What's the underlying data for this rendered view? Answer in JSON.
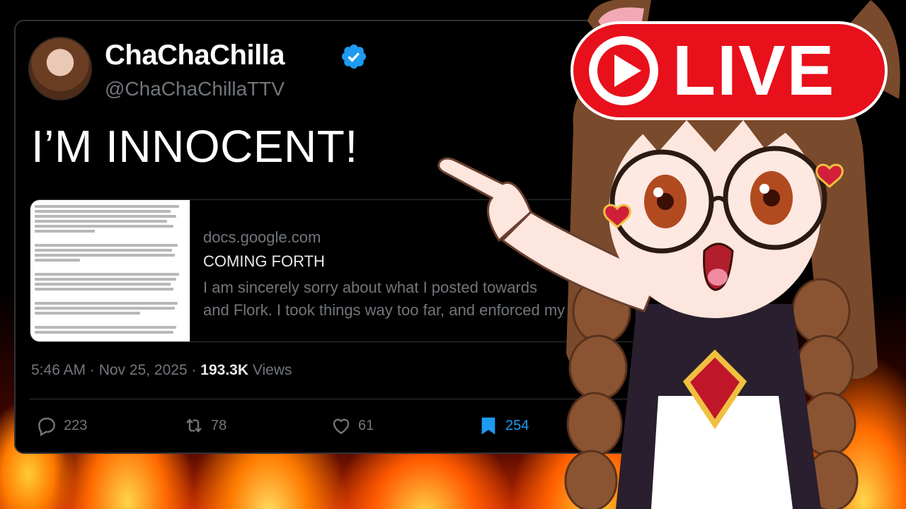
{
  "tweet": {
    "display_name": "ChaChaChilla",
    "handle": "@ChaChaChillaTTV",
    "text": "I’M INNOCENT!",
    "link_card": {
      "domain": "docs.google.com",
      "title": "COMING FORTH",
      "description_line1": "I am sincerely sorry about what I posted towards",
      "description_line2": "and Flork. I took things way too far, and enforced my"
    },
    "timestamp": "5:46 AM · Nov 25, 2025 · ",
    "views_count": "193.3K",
    "views_label": " Views",
    "actions": {
      "replies": "223",
      "reposts": "78",
      "likes": "61",
      "bookmarks": "254"
    }
  },
  "badge": {
    "label": "LIVE"
  },
  "colors": {
    "live_red": "#e8101b",
    "verified_blue": "#1d9bf0",
    "muted_text": "#71767b",
    "card_border": "#2f3336"
  },
  "icons": [
    "verified-badge-icon",
    "reply-icon",
    "repost-icon",
    "like-icon",
    "bookmark-icon",
    "play-icon"
  ]
}
